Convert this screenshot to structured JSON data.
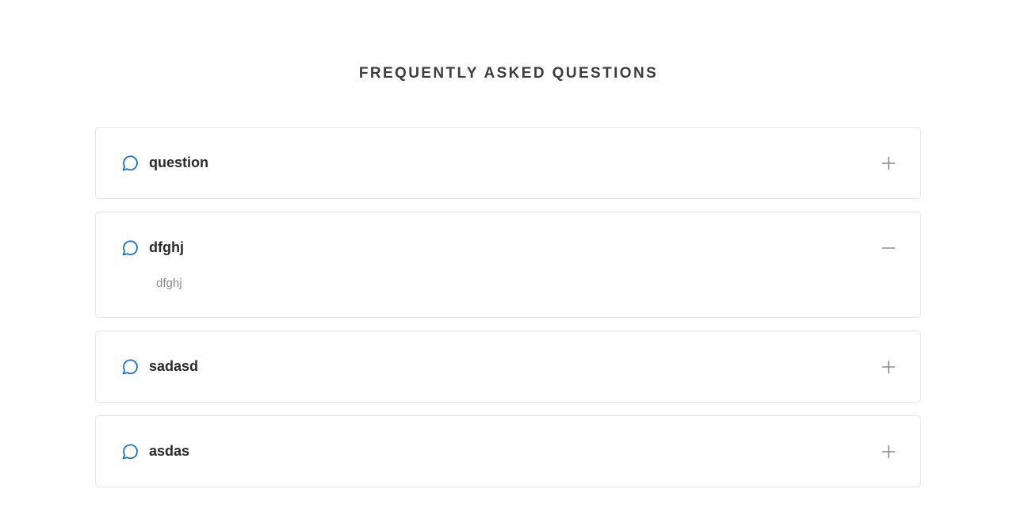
{
  "header": {
    "title": "FREQUENTLY ASKED QUESTIONS"
  },
  "colors": {
    "accent": "#1a73c9",
    "toggle": "#8c8c8c",
    "border": "#e6e6e6"
  },
  "faq": {
    "items": [
      {
        "question": "question",
        "answer": "",
        "expanded": false
      },
      {
        "question": "dfghj",
        "answer": "dfghj",
        "expanded": true
      },
      {
        "question": "sadasd",
        "answer": "",
        "expanded": false
      },
      {
        "question": "asdas",
        "answer": "",
        "expanded": false
      }
    ]
  },
  "icons": {
    "question": "chat-bubble-icon",
    "collapsed": "plus-icon",
    "expanded": "minus-icon"
  }
}
